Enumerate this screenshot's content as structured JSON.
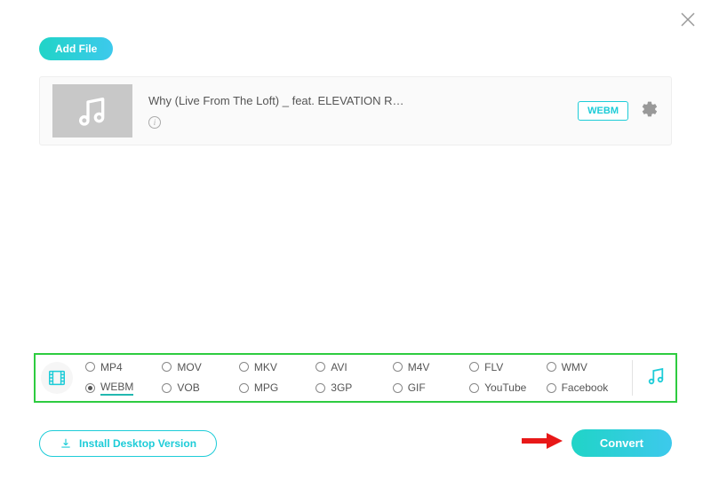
{
  "header": {
    "add_file_label": "Add File"
  },
  "file": {
    "title": "Why (Live From The Loft) _ feat. ELEVATION R…",
    "format_badge": "WEBM"
  },
  "formats": {
    "row1": [
      {
        "value": "MP4",
        "selected": false
      },
      {
        "value": "MOV",
        "selected": false
      },
      {
        "value": "MKV",
        "selected": false
      },
      {
        "value": "AVI",
        "selected": false
      },
      {
        "value": "M4V",
        "selected": false
      },
      {
        "value": "FLV",
        "selected": false
      },
      {
        "value": "WMV",
        "selected": false
      }
    ],
    "row2": [
      {
        "value": "WEBM",
        "selected": true
      },
      {
        "value": "VOB",
        "selected": false
      },
      {
        "value": "MPG",
        "selected": false
      },
      {
        "value": "3GP",
        "selected": false
      },
      {
        "value": "GIF",
        "selected": false
      },
      {
        "value": "YouTube",
        "selected": false
      },
      {
        "value": "Facebook",
        "selected": false
      }
    ]
  },
  "footer": {
    "install_label": "Install Desktop Version",
    "convert_label": "Convert"
  },
  "colors": {
    "accent": "#1dccd8",
    "highlight_border": "#2ecc40",
    "arrow": "#e81818"
  }
}
